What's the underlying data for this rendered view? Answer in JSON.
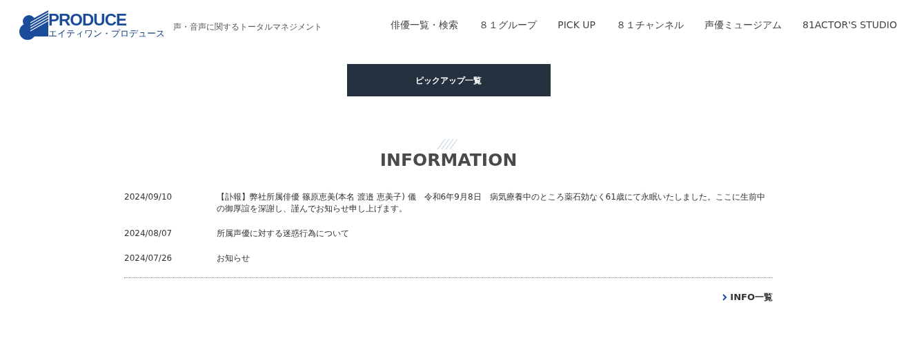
{
  "header": {
    "logo": {
      "wordmark": "PRODUCE",
      "subtitle": "エイティワン・プロデュース"
    },
    "tagline": "声・音声に関するトータルマネジメント",
    "nav": [
      {
        "label": "俳優一覧・検索"
      },
      {
        "label": "８１グループ"
      },
      {
        "label": "PICK UP"
      },
      {
        "label": "８１チャンネル"
      },
      {
        "label": "声優ミュージアム"
      },
      {
        "label": "81ACTOR'S STUDIO"
      }
    ]
  },
  "pickup_button": "ピックアップ一覧",
  "information": {
    "title": "INFORMATION",
    "items": [
      {
        "date": "2024/09/10",
        "text": "【訃報】弊社所属俳優 篠原恵美(本名 渡邉 恵美子) 儀　令和6年9月8日　病気療養中のところ薬石効なく61歳にて永眠いたしました。ここに生前中の御厚誼を深謝し、謹んでお知らせ申し上げます。"
      },
      {
        "date": "2024/08/07",
        "text": "所属声優に対する迷惑行為について"
      },
      {
        "date": "2024/07/26",
        "text": "お知らせ"
      }
    ],
    "more_link": "INFO一覧"
  }
}
